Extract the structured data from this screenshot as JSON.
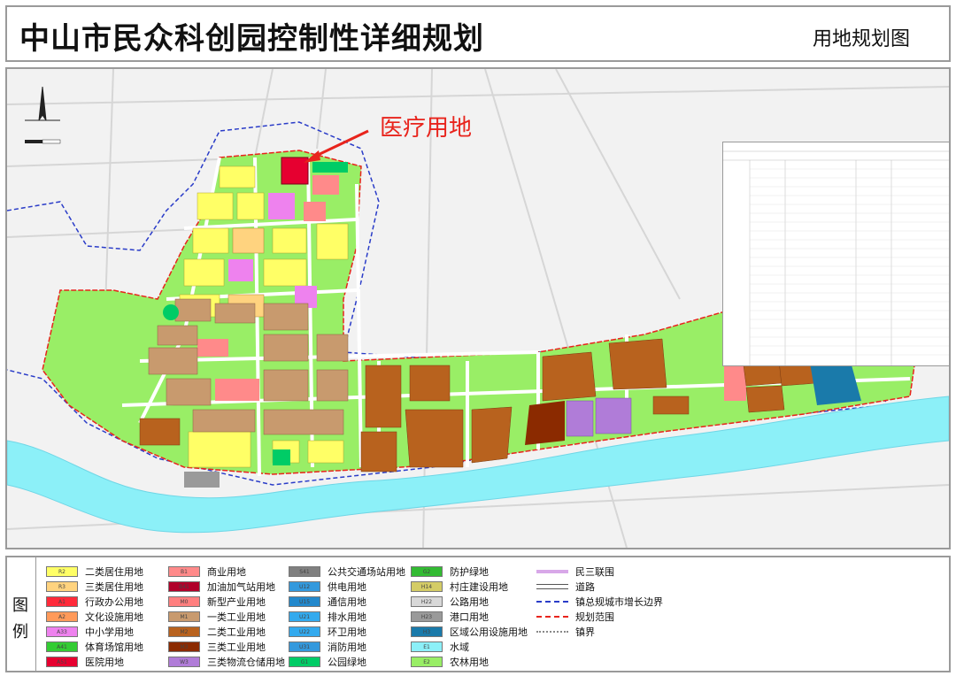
{
  "header": {
    "title": "中山市民众科创园控制性详细规划",
    "subtitle": "用地规划图"
  },
  "callout": {
    "label": "医疗用地",
    "color": "#e8241c"
  },
  "legend": {
    "title_top": "图",
    "title_bottom": "例",
    "items": [
      {
        "code": "R2",
        "label": "二类居住用地",
        "color": "#ffff66"
      },
      {
        "code": "R3",
        "label": "三类居住用地",
        "color": "#ffd37f"
      },
      {
        "code": "A1",
        "label": "行政办公用地",
        "color": "#ff2a3a"
      },
      {
        "code": "A2",
        "label": "文化设施用地",
        "color": "#ff9a5a"
      },
      {
        "code": "A33",
        "label": "中小学用地",
        "color": "#ee82ee"
      },
      {
        "code": "A41",
        "label": "体育场馆用地",
        "color": "#33cc33"
      },
      {
        "code": "A51",
        "label": "医院用地",
        "color": "#e60030"
      },
      {
        "code": "B1",
        "label": "商业用地",
        "color": "#ff8a8a"
      },
      {
        "code": "B41",
        "label": "加油加气站用地",
        "color": "#b0002a"
      },
      {
        "code": "M0",
        "label": "新型产业用地",
        "color": "#ff7f7f"
      },
      {
        "code": "M1",
        "label": "一类工业用地",
        "color": "#c89a6e"
      },
      {
        "code": "M2",
        "label": "二类工业用地",
        "color": "#b8621e"
      },
      {
        "code": "M3",
        "label": "三类工业用地",
        "color": "#8b2a00"
      },
      {
        "code": "W3",
        "label": "三类物流仓储用地",
        "color": "#b07cd8"
      },
      {
        "code": "S41",
        "label": "公共交通场站用地",
        "color": "#808080"
      },
      {
        "code": "U12",
        "label": "供电用地",
        "color": "#3399dd"
      },
      {
        "code": "U15",
        "label": "通信用地",
        "color": "#2288cc"
      },
      {
        "code": "U21",
        "label": "排水用地",
        "color": "#33aaee"
      },
      {
        "code": "U22",
        "label": "环卫用地",
        "color": "#33aaee"
      },
      {
        "code": "U31",
        "label": "消防用地",
        "color": "#3399dd"
      },
      {
        "code": "G1",
        "label": "公园绿地",
        "color": "#00cc66"
      },
      {
        "code": "G2",
        "label": "防护绿地",
        "color": "#33bb33"
      },
      {
        "code": "H14",
        "label": "村庄建设用地",
        "color": "#d4cc66"
      },
      {
        "code": "H22",
        "label": "公路用地",
        "color": "#d8d8d8"
      },
      {
        "code": "H23",
        "label": "港口用地",
        "color": "#9a9a9a"
      },
      {
        "code": "H3",
        "label": "区域公用设施用地",
        "color": "#1a7aaa"
      },
      {
        "code": "E1",
        "label": "水域",
        "color": "#8cf0f8"
      },
      {
        "code": "E2",
        "label": "农林用地",
        "color": "#99ee66"
      },
      {
        "code": "",
        "label": "民三联围",
        "color": "#d8a8e8"
      },
      {
        "code": "",
        "label": "道路",
        "color": "#ffffff"
      },
      {
        "code": "",
        "label": "镇总规城市增长边界",
        "color": "#2a3cc8"
      },
      {
        "code": "",
        "label": "规划范围",
        "color": "#e8241c"
      },
      {
        "code": "",
        "label": "镇界",
        "color": "#888888"
      }
    ]
  },
  "colors": {
    "water": "#8cf0f8",
    "farmland": "#99ee66",
    "residential": "#ffff66",
    "industrial2": "#b8621e",
    "industrial1": "#c89a6e",
    "industrial3": "#8b2a00",
    "hospital": "#e60030"
  }
}
